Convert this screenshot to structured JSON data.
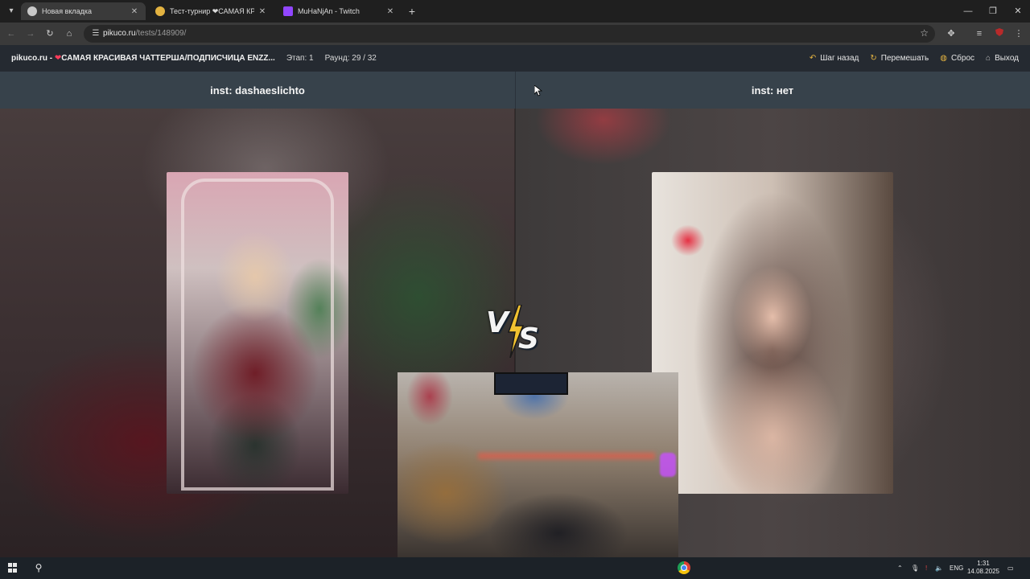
{
  "browser": {
    "tabs": [
      {
        "title": "Новая вкладка",
        "active": true,
        "favicon_color": "#8ab4f8"
      },
      {
        "title": "Тест-турнир ❤САМАЯ КРАСИВАЯ",
        "active": false,
        "favicon_color": "#e3b341"
      },
      {
        "title": "MuHaNjAn - Twitch",
        "active": false,
        "favicon_color": "#9146ff"
      }
    ],
    "url_host": "pikuco.ru",
    "url_path": "/tests/148909/"
  },
  "site": {
    "title_prefix": "pikuco.ru - ",
    "heart": "❤",
    "title": "САМАЯ КРАСИВАЯ ЧАТТЕРША/ПОДПИСЧИЦА ENZZ...",
    "stage": "Этап: 1",
    "round": "Раунд: 29 / 32",
    "actions": {
      "back": "Шаг назад",
      "shuffle": "Перемешать",
      "reset": "Сброс",
      "exit": "Выход"
    },
    "accent_color": "#e3b341"
  },
  "game": {
    "left_name": "inst: dashaeslichto",
    "right_name": "inst: нет",
    "vs_v": "V",
    "vs_s": "S"
  },
  "taskbar": {
    "lang": "ENG",
    "time": "1:31",
    "date": "14.08.2025"
  }
}
